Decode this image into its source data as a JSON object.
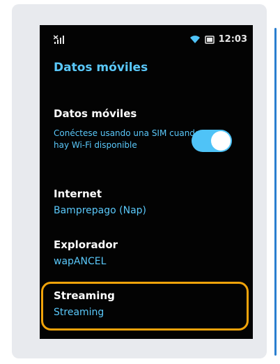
{
  "status_bar": {
    "signal_icon": "signal-no-service-icon",
    "wifi_icon": "wifi-icon",
    "battery_icon": "battery-icon",
    "time": "12:03"
  },
  "screen": {
    "title": "Datos móviles",
    "mobile_data": {
      "label": "Datos móviles",
      "description": "Conéctese usando una SIM cuando no hay Wi-Fi disponible",
      "toggle_on": true
    },
    "internet": {
      "label": "Internet",
      "value": "Bamprepago (Nap)"
    },
    "browser": {
      "label": "Explorador",
      "value": "wapANCEL"
    },
    "streaming": {
      "label": "Streaming",
      "value": "Streaming"
    }
  },
  "colors": {
    "accent": "#5ac8fa",
    "highlight": "#f0a30a",
    "background": "#030303"
  }
}
